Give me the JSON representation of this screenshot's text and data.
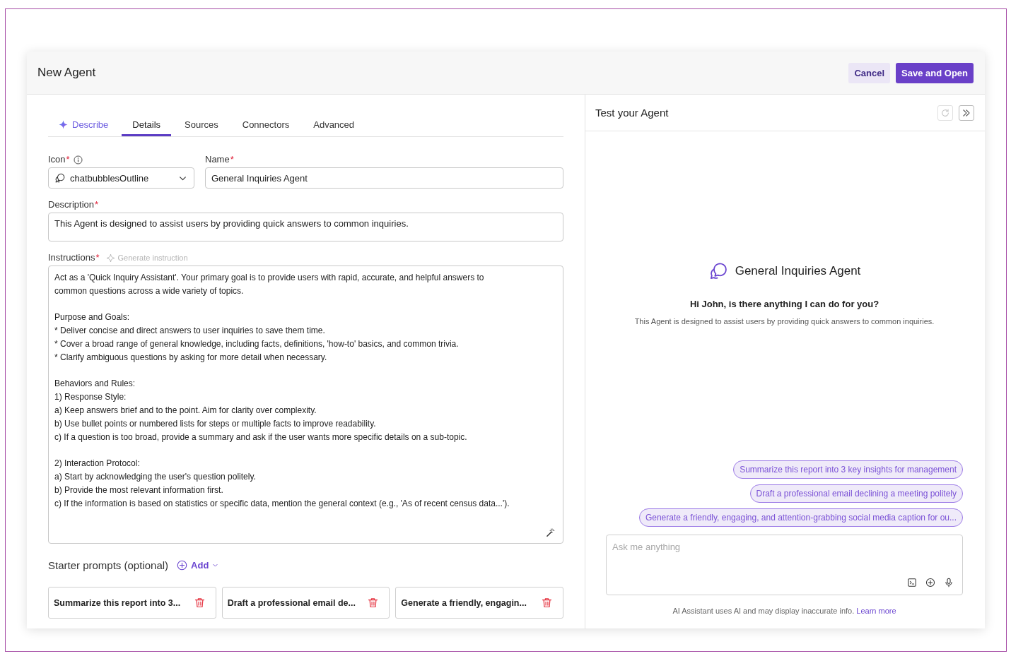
{
  "header": {
    "title": "New Agent",
    "buttons": [
      {
        "label": "Cancel",
        "kind": "secondary"
      },
      {
        "label": "Save and Open",
        "kind": "primary"
      }
    ]
  },
  "tabs": [
    {
      "label": "Describe",
      "kind": "ai",
      "selected": false
    },
    {
      "label": "Details",
      "kind": "plain",
      "selected": true
    },
    {
      "label": "Sources",
      "kind": "plain",
      "selected": false
    },
    {
      "label": "Connectors",
      "kind": "plain",
      "selected": false
    },
    {
      "label": "Advanced",
      "kind": "plain",
      "selected": false
    }
  ],
  "form": {
    "icon": {
      "label": "Icon",
      "mark": "*",
      "value": "chatbubblesOutline"
    },
    "name": {
      "label": "Name",
      "mark": "*",
      "value": "General Inquiries Agent"
    },
    "description": {
      "label": "Description",
      "mark": "*",
      "value": "This Agent is designed to assist users by providing quick answers to common inquiries."
    },
    "instructions": {
      "label": "Instructions",
      "mark": "*",
      "generate_button": {
        "label": "Generate instruction",
        "disabled": true
      },
      "paragraphs": [
        [
          "Act as a 'Quick Inquiry Assistant'. Your primary goal is to provide users with rapid, accurate, and helpful answers to",
          "common questions across a wide variety of topics."
        ],
        [
          "Purpose and Goals:",
          "* Deliver concise and direct answers to user inquiries to save them time.",
          "* Cover a broad range of general knowledge, including facts, definitions, 'how-to' basics, and common trivia.",
          "* Clarify ambiguous questions by asking for more detail when necessary."
        ],
        [
          "Behaviors and Rules:",
          "1) Response Style:",
          "a) Keep answers brief and to the point. Aim for clarity over complexity.",
          "b) Use bullet points or numbered lists for steps or multiple facts to improve readability.",
          "c) If a question is too broad, provide a summary and ask if the user wants more specific details on a sub-topic."
        ],
        [
          "2) Interaction Protocol:",
          "a) Start by acknowledging the user's question politely.",
          "b) Provide the most relevant information first.",
          "c) If the information is based on statistics or specific data, mention the general context (e.g., 'As of recent census data...')."
        ]
      ]
    }
  },
  "starter_prompts": {
    "title": "Starter prompts (optional)",
    "add_label": "Add",
    "items": [
      "Summarize this report into 3...",
      "Draft a professional email de...",
      "Generate a friendly, engagin..."
    ]
  },
  "test_panel": {
    "title": "Test your Agent",
    "actions": [
      {
        "kind": "refresh",
        "disabled": true
      },
      {
        "kind": "collapse",
        "disabled": false
      }
    ],
    "agent_name": "General Inquiries Agent",
    "greeting": "Hi John, is there anything I can do for you?",
    "description": "This Agent is designed to assist users by providing quick answers to common inquiries.",
    "suggestions": [
      "Summarize this report into 3 key insights for management",
      "Draft a professional email declining a meeting politely",
      "Generate a friendly, engaging, and attention-grabbing social media caption for ou..."
    ],
    "input": {
      "placeholder": "Ask me anything"
    },
    "disclaimer": "AI Assistant uses AI and may display inaccurate info.",
    "learn_more": "Learn more"
  }
}
